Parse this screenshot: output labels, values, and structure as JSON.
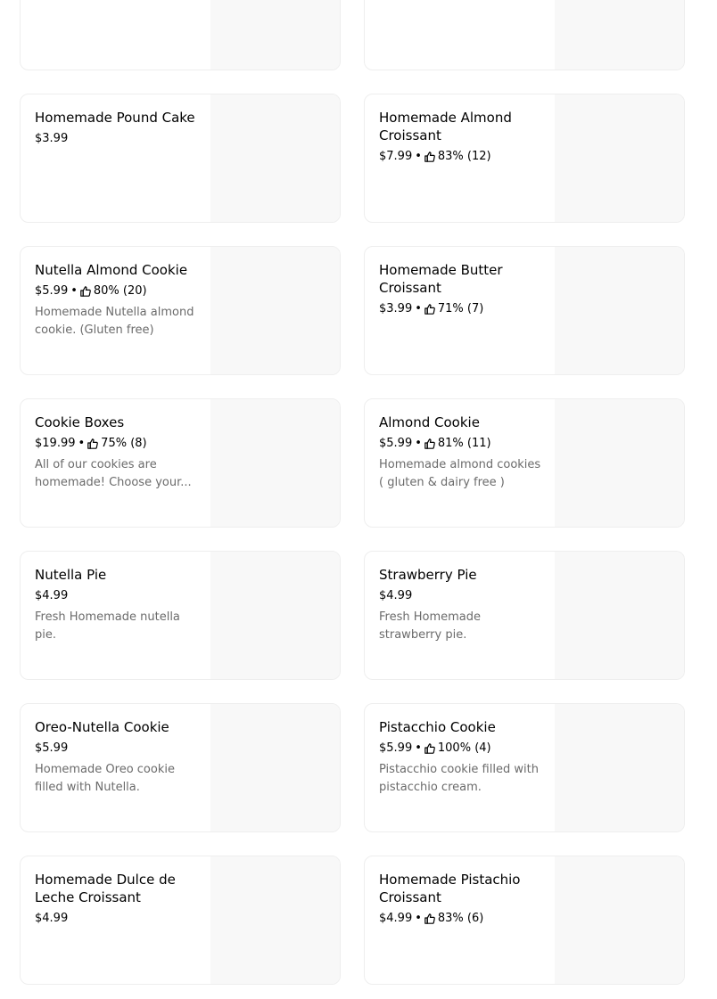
{
  "menu": {
    "items": [
      {
        "name": "",
        "price": "",
        "rating": "",
        "description": ""
      },
      {
        "name": "",
        "price": "",
        "rating": "",
        "description": ""
      },
      {
        "name": "Homemade Pound Cake",
        "price": "$3.99",
        "rating": "",
        "description": ""
      },
      {
        "name": "Homemade Almond Croissant",
        "price": "$7.99",
        "rating": "83% (12)",
        "description": ""
      },
      {
        "name": "Nutella Almond Cookie",
        "price": "$5.99",
        "rating": "80% (20)",
        "description": "Homemade Nutella almond cookie. (Gluten free)"
      },
      {
        "name": "Homemade Butter Croissant",
        "price": "$3.99",
        "rating": "71% (7)",
        "description": ""
      },
      {
        "name": "Cookie Boxes",
        "price": "$19.99",
        "rating": "75% (8)",
        "description": "All of our cookies are homemade! Choose your..."
      },
      {
        "name": "Almond Cookie",
        "price": "$5.99",
        "rating": "81% (11)",
        "description": "Homemade almond cookies ( gluten & dairy free )"
      },
      {
        "name": "Nutella Pie",
        "price": "$4.99",
        "rating": "",
        "description": "Fresh Homemade nutella pie."
      },
      {
        "name": "Strawberry Pie",
        "price": "$4.99",
        "rating": "",
        "description": "Fresh Homemade strawberry pie."
      },
      {
        "name": "Oreo-Nutella Cookie",
        "price": "$5.99",
        "rating": "",
        "description": "Homemade Oreo cookie filled with Nutella."
      },
      {
        "name": "Pistacchio Cookie",
        "price": "$5.99",
        "rating": "100% (4)",
        "description": "Pistacchio cookie filled with pistacchio cream."
      },
      {
        "name": "Homemade Dulce de Leche Croissant",
        "price": "$4.99",
        "rating": "",
        "description": ""
      },
      {
        "name": "Homemade Pistachio Croissant",
        "price": "$4.99",
        "rating": "83% (6)",
        "description": ""
      }
    ]
  },
  "icons": {
    "rating": "thumbs-up-icon"
  },
  "colors": {
    "card_border": "#eeeeee",
    "image_placeholder": "#f8f8f8",
    "description_text": "#6b6b6b",
    "primary_text": "#000000"
  }
}
